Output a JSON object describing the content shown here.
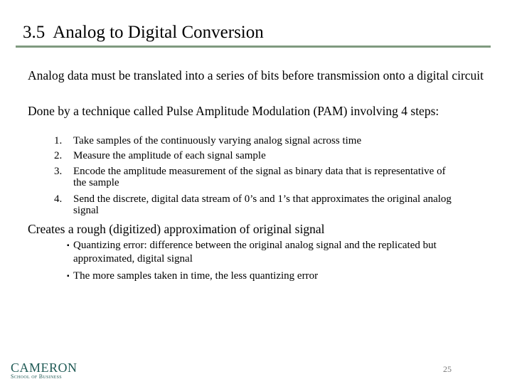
{
  "slide": {
    "section_number": "3.5",
    "title": "Analog to Digital Conversion",
    "page_number": "25",
    "accent_color": "#7f9a7f"
  },
  "body": {
    "para1": "Analog data must be translated into a series of bits before transmission onto a digital circuit",
    "para2": "Done by a technique called Pulse Amplitude Modulation (PAM) involving 4 steps:",
    "steps": [
      {
        "marker": "1.",
        "text": "Take samples of the continuously varying analog signal across time"
      },
      {
        "marker": "2.",
        "text": "Measure the amplitude of each signal sample"
      },
      {
        "marker": "3.",
        "text": "Encode the amplitude measurement of the signal as  binary data that is representative of the sample"
      },
      {
        "marker": "4.",
        "text": "Send the discrete, digital data stream of 0’s and 1’s that approximates the original analog signal"
      }
    ],
    "para3": "Creates a rough (digitized) approximation of original signal",
    "bullets": [
      {
        "marker": "▪",
        "text": "Quantizing error: difference between the original analog signal and the replicated but approximated, digital signal"
      },
      {
        "marker": "▪",
        "text": "The more samples taken in time, the less quantizing error"
      }
    ]
  },
  "footer": {
    "logo_main": "CAMERON",
    "logo_sub": "School of Business"
  }
}
